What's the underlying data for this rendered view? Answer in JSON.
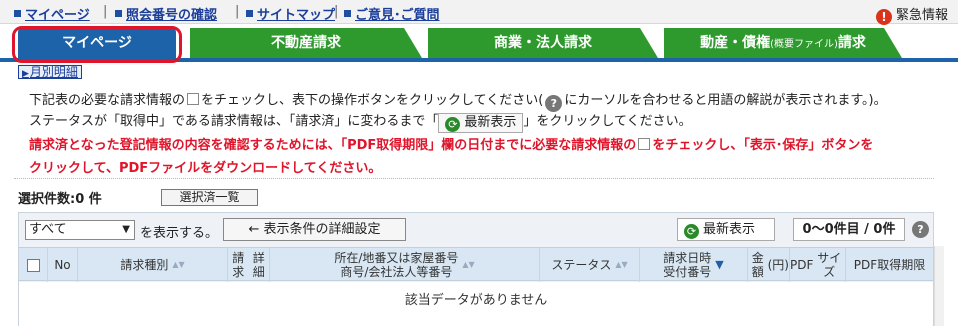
{
  "topnav": {
    "links": [
      "マイページ",
      "照会番号の確認",
      "サイトマップ",
      "ご意見･ご質問"
    ],
    "separator": "|",
    "emergency": "緊急情報",
    "emergency_icon": "!"
  },
  "tabs": [
    {
      "label": "マイページ",
      "active": true
    },
    {
      "label": "不動産請求",
      "active": false
    },
    {
      "label": "商業・法人請求",
      "active": false
    },
    {
      "label_main": "動産・債権",
      "label_small": "(概要ファイル)",
      "label_tail": "請求",
      "active": false
    }
  ],
  "month_link": "月別明細",
  "instructions": {
    "line1_a": "下記表の必要な請求情報の",
    "line1_b": "をチェックし、表下の操作ボタンをクリックしてください(",
    "line1_c": "にカーソルを合わせると用語の解説が表示されます。)。",
    "line2_a": "ステータスが「取得中」である請求情報は、「請求済」に変わるまで「",
    "line2_btn": "最新表示",
    "line2_b": "」をクリックしてください。",
    "line3_a": "請求済となった登記情報の内容を確認するためには、「PDF取得期限」欄の日付までに必要な請求情報の",
    "line3_b": "をチェックし、「表示･保存」ボタンを",
    "line4": "クリックして、PDFファイルをダウンロードしてください。"
  },
  "selected": {
    "label": "選択件数:0 件",
    "list_button": "選択済一覧"
  },
  "results": {
    "filter_value": "すべて",
    "filter_suffix": "を表示する。",
    "detail_button": "← 表示条件の詳細設定",
    "refresh_button": "最新表示",
    "range": "0～0件目 / 0件",
    "help": "?",
    "columns": {
      "no": "No",
      "type": "請求種別",
      "detail_1": "請求",
      "detail_2": "詳細",
      "location_1": "所在/地番又は家屋番号",
      "location_2": "商号/会社法人等番号",
      "status": "ステータス",
      "date_1": "請求日時",
      "date_2": "受付番号",
      "amount_1": "金額",
      "amount_2": "(円)",
      "size_1": "PDF",
      "size_2": "サイズ",
      "deadline_1": "PDF",
      "deadline_2": "取得期限"
    },
    "empty_message": "該当データがありません"
  },
  "colors": {
    "tab_active": "#1d63a9",
    "tab_inactive": "#2e9a2e",
    "highlight": "#e0142a",
    "warning_text": "#e0142a",
    "link": "#1a3e9a"
  }
}
